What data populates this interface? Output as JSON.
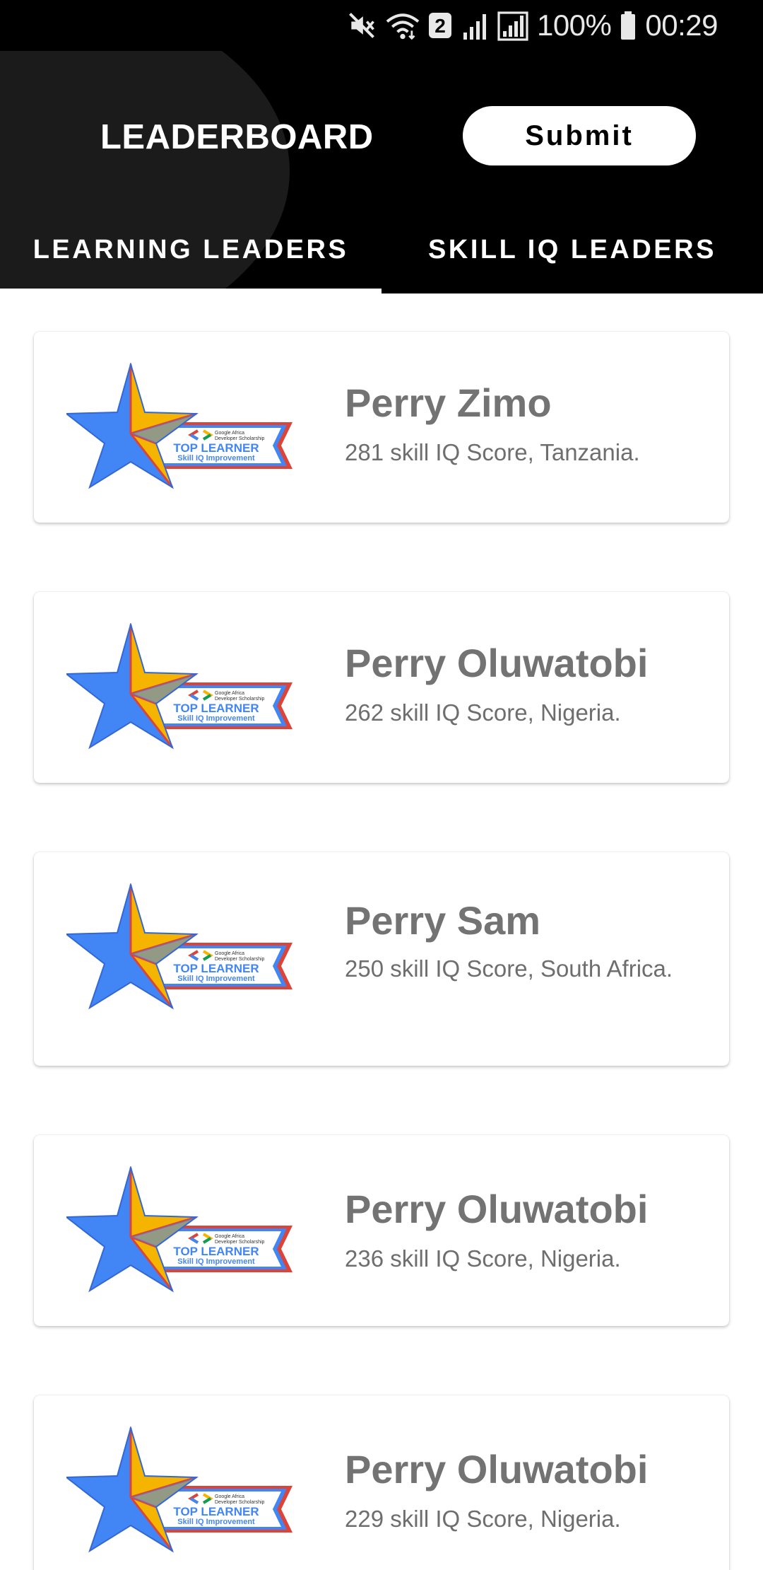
{
  "status_bar": {
    "network_badge": "2",
    "battery": "100%",
    "time": "00:29",
    "icons": [
      "mute-icon",
      "wifi-icon",
      "signal-icon",
      "signal-icon",
      "battery-icon"
    ]
  },
  "header": {
    "title": "LEADERBOARD",
    "submit_label": "Submit"
  },
  "tabs": [
    {
      "label": "LEARNING LEADERS",
      "active": true
    },
    {
      "label": "SKILL IQ LEADERS",
      "active": false
    }
  ],
  "badge": {
    "line1": "Google Africa",
    "line2": "Developer Scholarship",
    "title": "TOP LEARNER",
    "subtitle": "Skill IQ Improvement"
  },
  "colors": {
    "star_blue": "#4285f4",
    "star_yellow": "#f4b400",
    "badge_red": "#db4437",
    "badge_green": "#0f9d58",
    "text_gray": "#737373"
  },
  "leaders": [
    {
      "name": "Perry Zimo",
      "detail": "281 skill IQ Score, Tanzania."
    },
    {
      "name": "Perry Oluwatobi",
      "detail": "262 skill IQ Score, Nigeria."
    },
    {
      "name": "Perry Sam",
      "detail": "250 skill IQ Score, South Africa."
    },
    {
      "name": "Perry Oluwatobi",
      "detail": "236 skill IQ Score, Nigeria."
    },
    {
      "name": "Perry Oluwatobi",
      "detail": "229 skill IQ Score, Nigeria."
    }
  ]
}
